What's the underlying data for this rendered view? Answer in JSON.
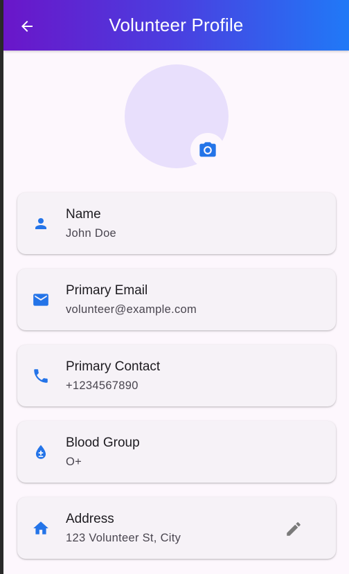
{
  "appbar": {
    "title": "Volunteer Profile",
    "back_icon": "arrow-back-icon"
  },
  "avatar": {
    "camera_icon": "camera-icon"
  },
  "colors": {
    "accent": "#2474e8",
    "gradient_start": "#6a16c9",
    "gradient_end": "#2079f7",
    "avatar_bg": "#e8dffc"
  },
  "fields": [
    {
      "title": "Name",
      "value": "John Doe",
      "icon": "person-icon"
    },
    {
      "title": "Primary Email",
      "value": "volunteer@example.com",
      "icon": "email-icon"
    },
    {
      "title": "Primary Contact",
      "value": "+1234567890",
      "icon": "phone-icon"
    },
    {
      "title": "Blood Group",
      "value": "O+",
      "icon": "blood-drop-icon"
    },
    {
      "title": "Address",
      "value": "123 Volunteer St, City",
      "icon": "home-icon",
      "edit_icon": "edit-pencil-icon"
    }
  ]
}
